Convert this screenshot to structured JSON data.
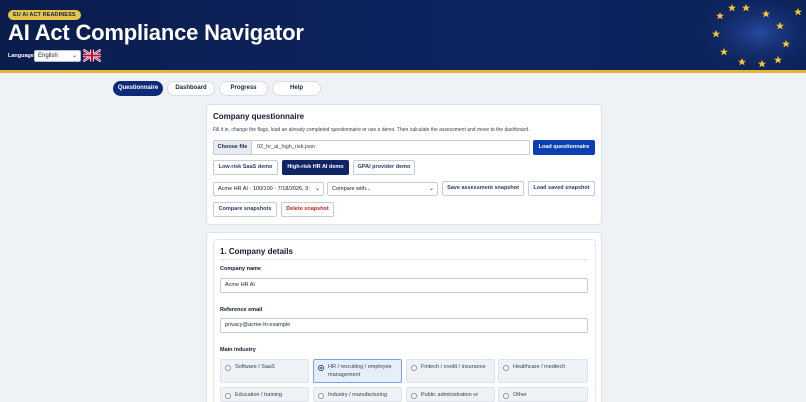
{
  "header": {
    "badge": "EU AI ACT READINESS",
    "title": "AI Act Compliance Navigator",
    "language_label": "Language",
    "language_value": "English",
    "flag_icon": "uk-flag-icon",
    "background_icon": "eu-stars-icon"
  },
  "tabs": [
    {
      "label": "Questionnaire",
      "active": true
    },
    {
      "label": "Dashboard",
      "active": false
    },
    {
      "label": "Progress",
      "active": false
    },
    {
      "label": "Help",
      "active": false
    }
  ],
  "questionnaire": {
    "title": "Company questionnaire",
    "description": "Fill it in, change the flags, load an already completed questionnaire or use a demo. Then calculate the assessment and move to the dashboard.",
    "choose_file_label": "Choose file",
    "file_name": "02_hr_ai_high_risk.json",
    "load_button": "Load questionnaire",
    "demos": {
      "low_risk": "Low-risk SaaS demo",
      "high_risk": "High-risk HR AI demo",
      "gpai": "GPAI provider demo"
    },
    "snapshot_select": "Acme HR AI · 100/100 · 7/18/2026, 3:",
    "compare_select": "Compare with...",
    "save_snapshot": "Save assessment snapshot",
    "load_snapshot": "Load saved snapshot",
    "compare_snapshots": "Compare snapshots",
    "delete_snapshot": "Delete snapshot"
  },
  "company": {
    "section_title": "1. Company details",
    "name_label": "Company name",
    "name_value": "Acme HR AI",
    "email_label": "Reference email",
    "email_value": "privacy@acme-hr.example",
    "industry_label": "Main industry",
    "industries": [
      {
        "label": "Software / SaaS",
        "selected": false
      },
      {
        "label": "HR / recruiting / employee management",
        "selected": true
      },
      {
        "label": "Fintech / credit / insurance",
        "selected": false
      },
      {
        "label": "Healthcare / medtech",
        "selected": false
      },
      {
        "label": "Education / training",
        "selected": false
      },
      {
        "label": "Industry / manufacturing",
        "selected": false
      },
      {
        "label": "Public administration or",
        "selected": false
      },
      {
        "label": "Other",
        "selected": false
      }
    ]
  },
  "colors": {
    "header_bg": "#0a1d4d",
    "accent_gold": "#e2b632",
    "primary": "#0d3fb4",
    "danger": "#c2261d"
  }
}
